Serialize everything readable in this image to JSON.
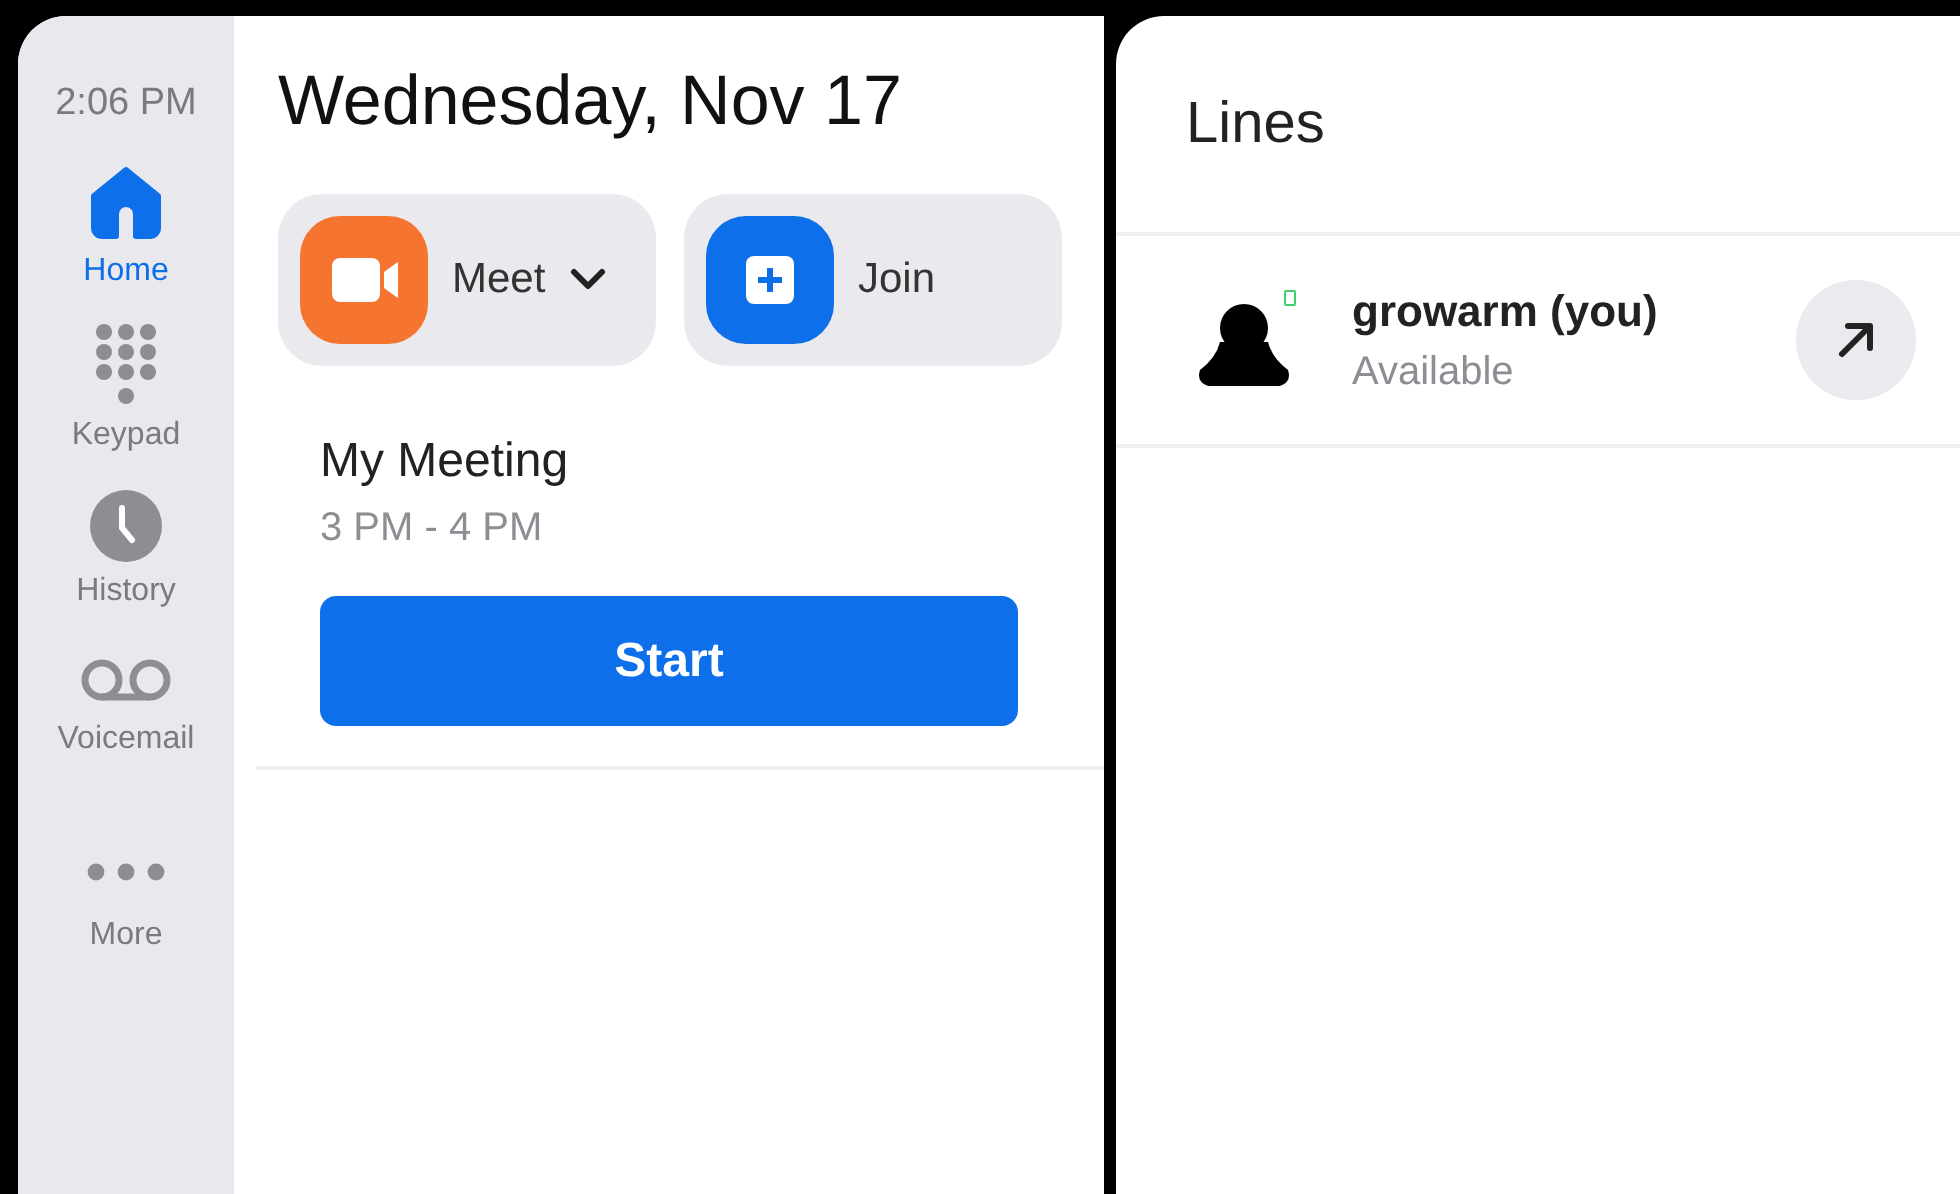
{
  "sidebar": {
    "time": "2:06 PM",
    "items": [
      {
        "kind": "home",
        "label": "Home",
        "selected": true
      },
      {
        "kind": "keypad",
        "label": "Keypad",
        "selected": false
      },
      {
        "kind": "history",
        "label": "History",
        "selected": false
      },
      {
        "kind": "voicemail",
        "label": "Voicemail",
        "selected": false
      },
      {
        "kind": "more",
        "label": "More",
        "selected": false
      }
    ]
  },
  "home": {
    "date": "Wednesday, Nov 17",
    "actions": [
      {
        "kind": "meet",
        "label": "Meet",
        "dropdown": true
      },
      {
        "kind": "join",
        "label": "Join",
        "dropdown": false
      }
    ],
    "meeting": {
      "title": "My Meeting",
      "time": "3 PM - 4 PM",
      "button": "Start"
    }
  },
  "lines": {
    "title": "Lines",
    "items": [
      {
        "name": "growarm (you)",
        "status": "Available",
        "color": "#3ccf6e"
      }
    ]
  }
}
